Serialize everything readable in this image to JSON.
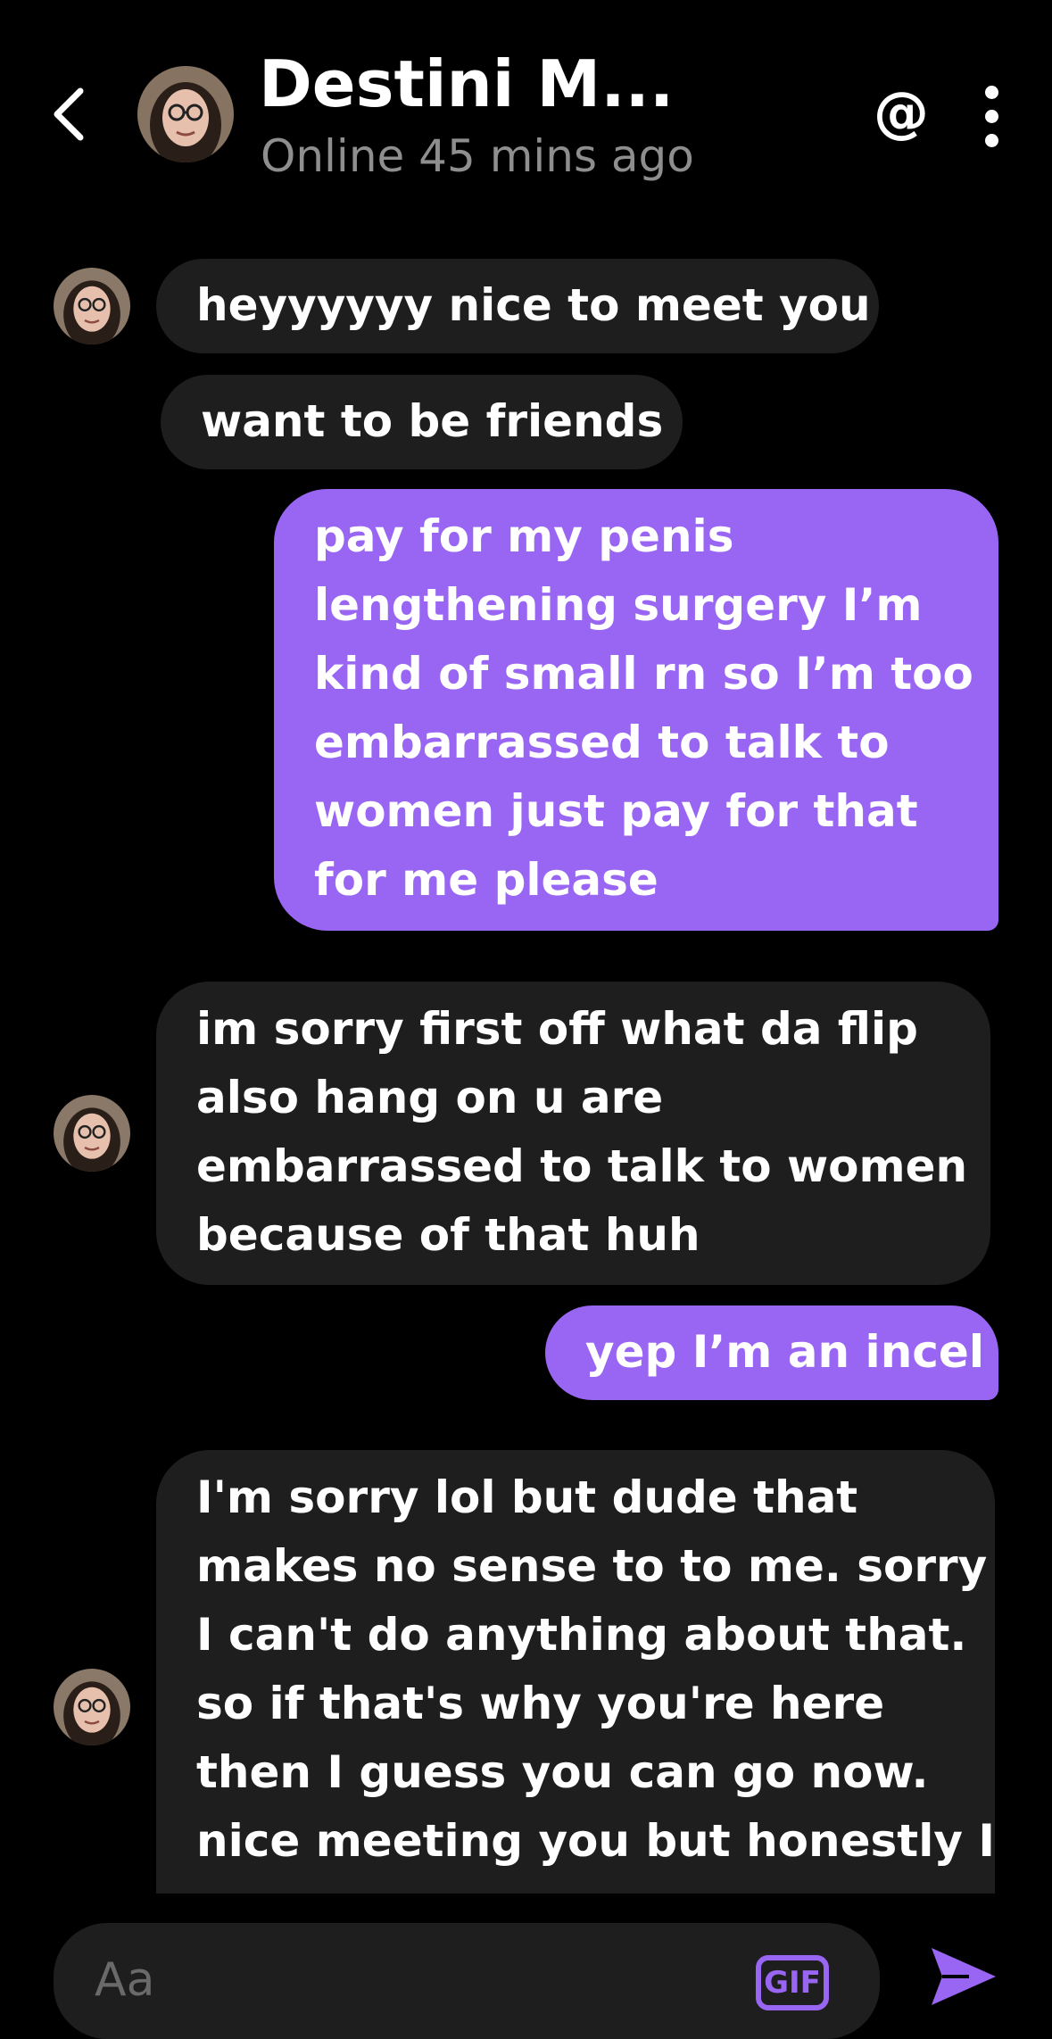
{
  "header": {
    "contact_name": "Destini M...",
    "status": "Online 45 mins ago",
    "mention_symbol": "@",
    "back_icon": "chevron-left-icon",
    "more_icon": "more-vertical-icon"
  },
  "messages": [
    {
      "direction": "incoming",
      "lines": [
        "heyyyyyy nice to meet you"
      ]
    },
    {
      "direction": "incoming",
      "lines": [
        "want to be friends"
      ]
    },
    {
      "direction": "outgoing",
      "lines": [
        "pay for my penis",
        "lengthening surgery I’m",
        "kind of small rn so I’m too",
        "embarrassed to talk to",
        "women just pay for that",
        "for me please"
      ]
    },
    {
      "direction": "incoming",
      "lines": [
        "im sorry first off what da flip",
        "also hang on u are",
        "embarrassed to talk to women",
        "because of that huh"
      ]
    },
    {
      "direction": "outgoing",
      "lines": [
        "yep I’m an incel"
      ]
    },
    {
      "direction": "incoming",
      "lines": [
        "I'm sorry lol but dude that",
        "makes no sense to to me. sorry",
        "I can't do anything about that.",
        "so if that's why you're here",
        "then I guess you can go now.",
        "nice meeting you but honestly I"
      ]
    }
  ],
  "composer": {
    "placeholder": "Aa",
    "gif_label": "GIF",
    "send_icon": "send-icon"
  },
  "colors": {
    "background": "#000000",
    "incoming_bubble": "#1e1e1e",
    "outgoing_bubble": "#9966f4",
    "status_text": "#8e8e8e"
  }
}
